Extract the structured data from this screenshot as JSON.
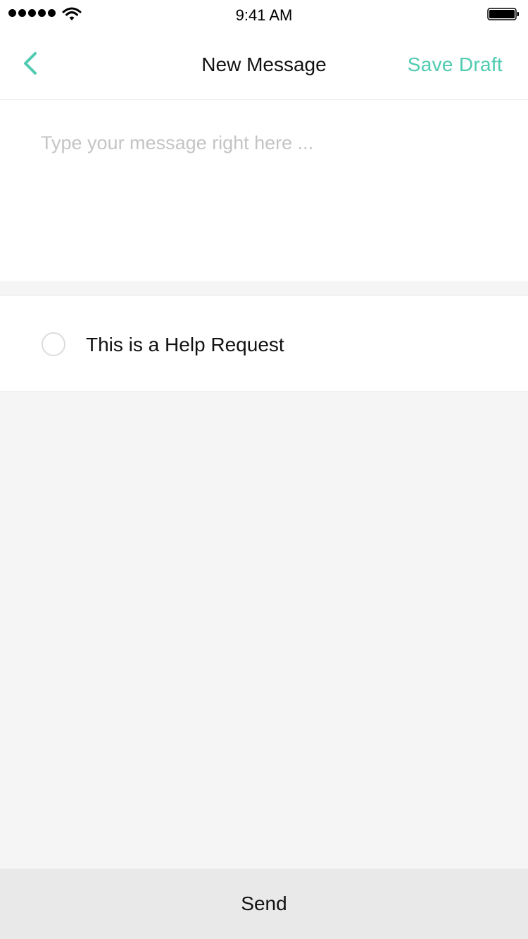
{
  "status_bar": {
    "time": "9:41 AM",
    "signal_icon": "signal-dots-icon",
    "wifi_icon": "wifi-icon",
    "battery_icon": "battery-icon"
  },
  "nav": {
    "back_icon": "chevron-left-icon",
    "title": "New Message",
    "save_draft_label": "Save Draft"
  },
  "message": {
    "value": "",
    "placeholder": "Type your message right here ..."
  },
  "help_request": {
    "label": "This is a Help Request",
    "checked": false
  },
  "footer": {
    "send_label": "Send"
  },
  "colors": {
    "accent": "#4ecbb0",
    "background": "#f5f5f5",
    "send_bar": "#e9e9e9",
    "placeholder": "#c4c4c4"
  }
}
